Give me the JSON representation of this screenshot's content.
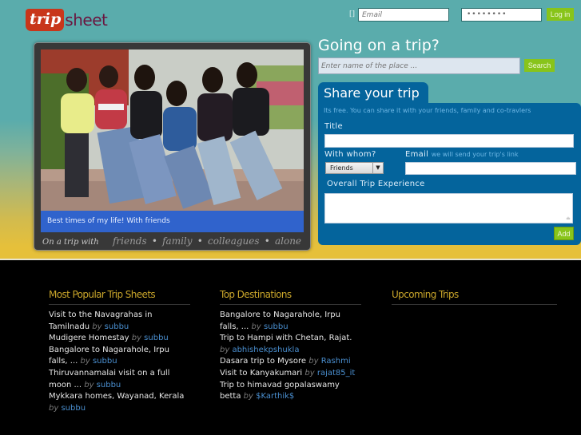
{
  "brand": {
    "logo_trip": "trip",
    "logo_sheet": "sheet"
  },
  "login": {
    "remember_glyph": "[]",
    "email_placeholder": "Email",
    "password_mask": "••••••••",
    "login_label": "Log in"
  },
  "photo": {
    "caption": "Best times of my life! With friends",
    "on_trip_with": "On a trip with",
    "options": [
      "friends",
      "family",
      "colleagues",
      "alone"
    ],
    "separator": "•"
  },
  "search": {
    "heading": "Going on a trip?",
    "placeholder": "Enter name of the place ...",
    "button_label": "Search"
  },
  "share": {
    "tab_label": "Share your trip",
    "subtitle": "Its free. You can share it with your friends, family and co-travlers",
    "title_label": "Title",
    "title_value": "",
    "with_whom_label": "With whom?",
    "with_whom_value": "Friends",
    "email_label": "Email",
    "email_hint": "we will send your trip's link",
    "email_value": "",
    "experience_label": "Overall Trip Experience",
    "experience_value": "",
    "add_label": "Add"
  },
  "footer": {
    "popular": {
      "heading": "Most Popular Trip Sheets",
      "items": [
        {
          "title": "Visit to the Navagrahas in Tamilnadu",
          "by": "by",
          "user": "subbu"
        },
        {
          "title": "Mudigere Homestay",
          "by": "by",
          "user": "subbu"
        },
        {
          "title": "Bangalore to Nagarahole, Irpu falls, ...",
          "by": "by",
          "user": "subbu"
        },
        {
          "title": "Thiruvannamalai visit on a full moon ...",
          "by": "by",
          "user": "subbu"
        },
        {
          "title": "Mykkara homes, Wayanad, Kerala",
          "by": "by",
          "user": "subbu"
        }
      ]
    },
    "destinations": {
      "heading": "Top Destinations",
      "items": [
        {
          "title": "Bangalore to Nagarahole, Irpu falls, ...",
          "by": "by",
          "user": "subbu"
        },
        {
          "title": "Trip to Hampi with Chetan, Rajat.",
          "by": "by",
          "user": "abhishekpshukla"
        },
        {
          "title": "Dasara trip to Mysore",
          "by": "by",
          "user": "Rashmi"
        },
        {
          "title": "Visit to Kanyakumari",
          "by": "by",
          "user": "rajat85_it"
        },
        {
          "title": "Trip to himavad gopalaswamy betta",
          "by": "by",
          "user": "$Karthik$"
        }
      ]
    },
    "upcoming": {
      "heading": "Upcoming Trips",
      "items": []
    }
  },
  "colors": {
    "teal_bg": "#5aacac",
    "yellow_bg": "#e6c03a",
    "panel_blue": "#04649c",
    "button_green": "#88c41a",
    "caption_blue": "#3063cc",
    "footer_heading": "#c9a52a",
    "link_blue": "#4a8fd0",
    "logo_red": "#c8361a",
    "logo_purple": "#6a1640"
  }
}
